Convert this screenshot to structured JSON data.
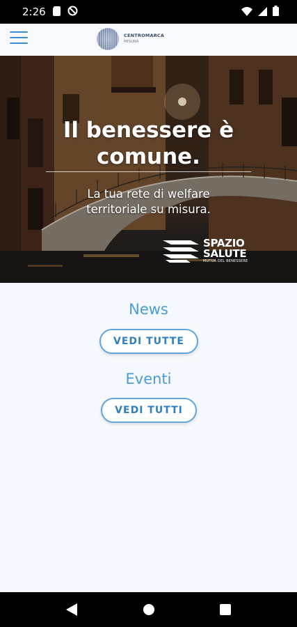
{
  "status_bar": {
    "time": "2:26",
    "icons": [
      "sim-card-icon",
      "do-not-disturb-icon",
      "wifi-icon",
      "signal-icon",
      "battery-icon"
    ]
  },
  "app_bar": {
    "logo_line1": "CENTROMARCA",
    "logo_line2": "MISURA",
    "accent_color": "#3a8fd0"
  },
  "hero": {
    "title_line1": "Il benessere è",
    "title_line2": "comune.",
    "subtitle_line1": "La tua rete di welfare",
    "subtitle_line2": "territoriale su misura.",
    "brand_line1": "SPAZIO",
    "brand_line2": "SALUTE",
    "brand_tagline": "MUTUA DEL BENESSERE"
  },
  "sections": {
    "news_title": "News",
    "news_button": "VEDI TUTTE",
    "events_title": "Eventi",
    "events_button": "VEDI TUTTI"
  },
  "nav_bar": {
    "icons": [
      "back-icon",
      "home-icon",
      "recents-icon"
    ]
  }
}
